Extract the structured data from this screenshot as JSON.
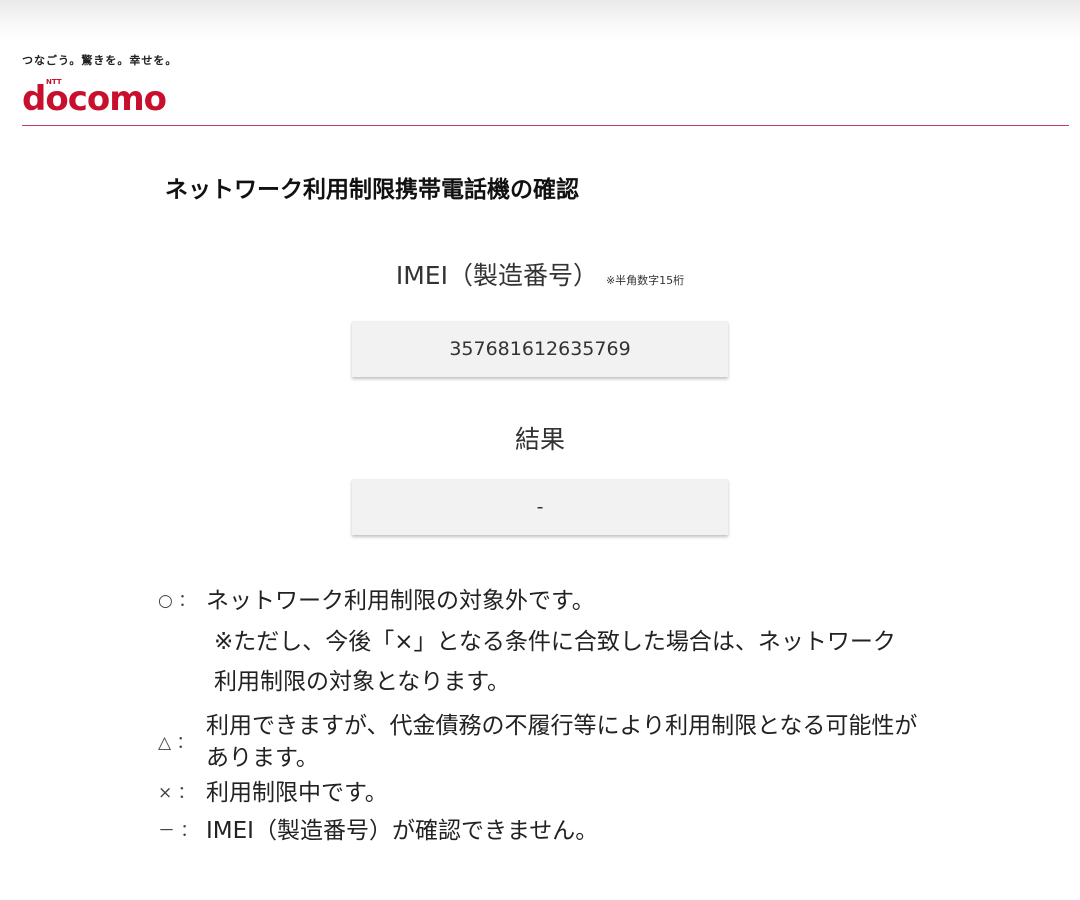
{
  "header": {
    "tagline": "つなごう。驚きを。幸せを。",
    "logo_small": "NTT",
    "logo_text": "docomo",
    "brand_color": "#c8102e"
  },
  "page_title": "ネットワーク利用制限携帯電話機の確認",
  "imei_field": {
    "label": "IMEI（製造番号）",
    "note": "※半角数字15桁",
    "value": "357681612635769"
  },
  "result_field": {
    "label": "結果",
    "value": "-"
  },
  "legend": {
    "circle": {
      "mark": "○ ：",
      "text": "ネットワーク利用制限の対象外です。",
      "sub": "※ただし、今後「×」となる条件に合致した場合は、ネットワーク利用制限の対象となります。"
    },
    "triangle": {
      "mark": "△ ：",
      "text": "利用できますが、代金債務の不履行等により利用制限となる可能性があります。"
    },
    "cross": {
      "mark": "× ：",
      "text": "利用制限中です。"
    },
    "dash": {
      "mark": "－ ：",
      "text": "IMEI（製造番号）が確認できません。"
    }
  }
}
